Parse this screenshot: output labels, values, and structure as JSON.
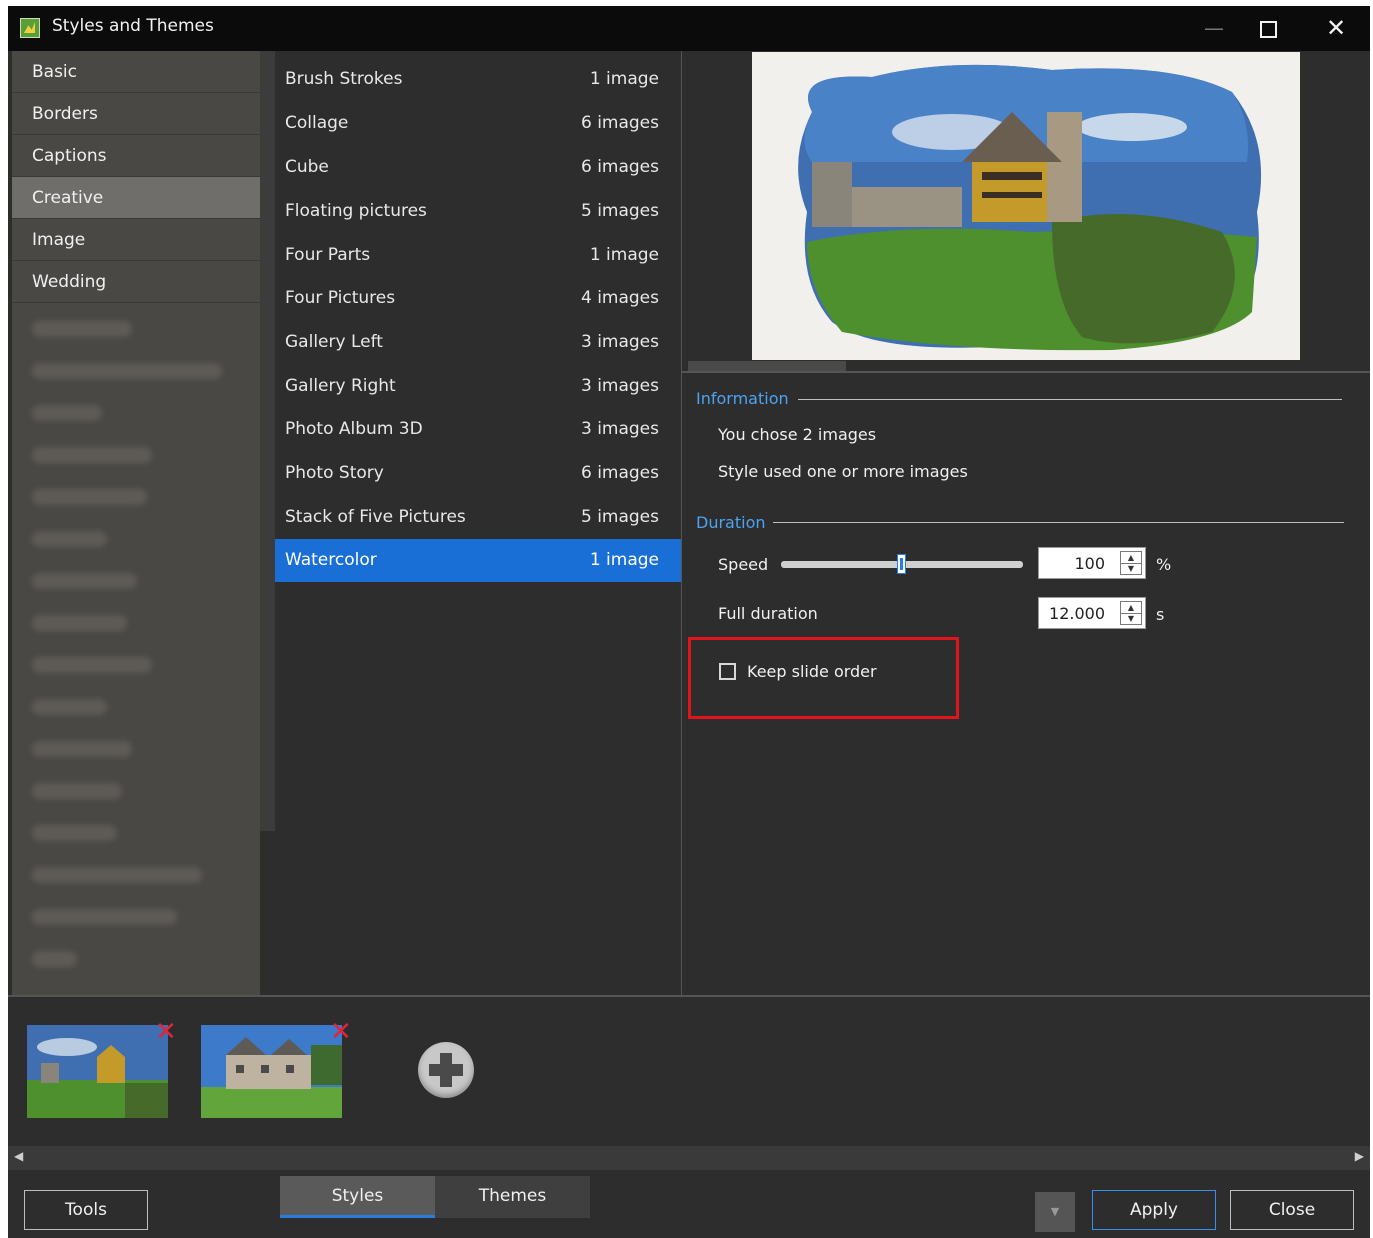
{
  "window": {
    "title": "Styles and Themes",
    "maximize_icon": "maximize-icon",
    "close_icon": "close-icon"
  },
  "categories": {
    "items": [
      {
        "label": "Basic"
      },
      {
        "label": "Borders"
      },
      {
        "label": "Captions"
      },
      {
        "label": "Creative",
        "active": true
      },
      {
        "label": "Image"
      },
      {
        "label": "Wedding"
      }
    ]
  },
  "styles": {
    "items": [
      {
        "name": "Brush Strokes",
        "count": "1 image"
      },
      {
        "name": "Collage",
        "count": "6 images"
      },
      {
        "name": "Cube",
        "count": "6 images"
      },
      {
        "name": "Floating pictures",
        "count": "5 images"
      },
      {
        "name": "Four Parts",
        "count": "1 image"
      },
      {
        "name": "Four Pictures",
        "count": "4 images"
      },
      {
        "name": "Gallery Left",
        "count": "3 images"
      },
      {
        "name": "Gallery Right",
        "count": "3 images"
      },
      {
        "name": "Photo Album 3D",
        "count": "3 images"
      },
      {
        "name": "Photo Story",
        "count": "6 images"
      },
      {
        "name": "Stack of Five Pictures",
        "count": "5 images"
      },
      {
        "name": "Watercolor",
        "count": "1 image",
        "selected": true
      }
    ]
  },
  "information": {
    "title": "Information",
    "line1": "You chose 2 images",
    "line2": "Style used one or more images"
  },
  "duration": {
    "title": "Duration",
    "speed_label": "Speed",
    "speed_value": "100",
    "speed_unit": "%",
    "speed_slider_fraction": 0.5,
    "full_duration_label": "Full duration",
    "full_duration_value": "12.000",
    "full_duration_unit": "s",
    "keep_slide_order_label": "Keep slide order",
    "keep_slide_order_checked": false
  },
  "buttons": {
    "tools": "Tools",
    "apply": "Apply",
    "close": "Close"
  },
  "tabs": {
    "styles": "Styles",
    "themes": "Themes"
  },
  "colors": {
    "accent": "#1a6fd6",
    "highlight_box": "#e0141c",
    "section_title": "#4da3f0"
  }
}
